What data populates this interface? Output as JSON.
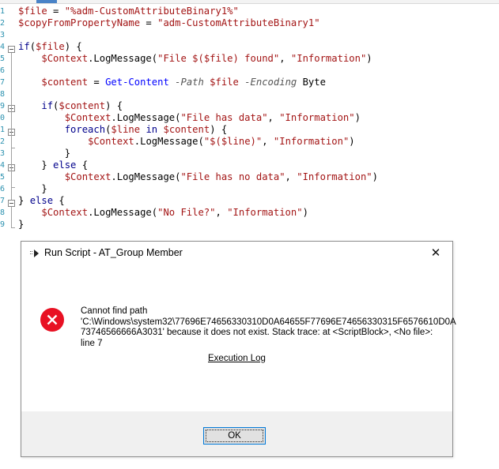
{
  "editor": {
    "gutter_numbers": [
      "1",
      "2",
      "3",
      "4",
      "5",
      "6",
      "7",
      "8",
      "9",
      "0",
      "1",
      "2",
      "3",
      "4",
      "5",
      "6",
      "7",
      "8",
      "9"
    ],
    "lines": [
      [
        [
          "var",
          "$file"
        ],
        [
          "op",
          " = "
        ],
        [
          "str",
          "\"%adm-CustomAttributeBinary1%\""
        ]
      ],
      [
        [
          "var",
          "$copyFromPropertyName"
        ],
        [
          "op",
          " = "
        ],
        [
          "str",
          "\"adm-CustomAttributeBinary1\""
        ]
      ],
      [],
      [
        [
          "kw",
          "if"
        ],
        [
          "pl",
          "("
        ],
        [
          "var",
          "$file"
        ],
        [
          "pl",
          ") {"
        ]
      ],
      [
        [
          "pl",
          "    "
        ],
        [
          "var",
          "$Context"
        ],
        [
          "pl",
          ".LogMessage("
        ],
        [
          "str",
          "\"File $($file) found\""
        ],
        [
          "pl",
          ", "
        ],
        [
          "str",
          "\"Information\""
        ],
        [
          "pl",
          ")"
        ]
      ],
      [],
      [
        [
          "pl",
          "    "
        ],
        [
          "var",
          "$content"
        ],
        [
          "op",
          " = "
        ],
        [
          "cmd",
          "Get-Content"
        ],
        [
          "pl",
          " "
        ],
        [
          "prm",
          "-Path"
        ],
        [
          "pl",
          " "
        ],
        [
          "var",
          "$file"
        ],
        [
          "pl",
          " "
        ],
        [
          "prm",
          "-Encoding"
        ],
        [
          "pl",
          " Byte"
        ]
      ],
      [],
      [
        [
          "pl",
          "    "
        ],
        [
          "kw",
          "if"
        ],
        [
          "pl",
          "("
        ],
        [
          "var",
          "$content"
        ],
        [
          "pl",
          ") {"
        ]
      ],
      [
        [
          "pl",
          "        "
        ],
        [
          "var",
          "$Context"
        ],
        [
          "pl",
          ".LogMessage("
        ],
        [
          "str",
          "\"File has data\""
        ],
        [
          "pl",
          ", "
        ],
        [
          "str",
          "\"Information\""
        ],
        [
          "pl",
          ")"
        ]
      ],
      [
        [
          "pl",
          "        "
        ],
        [
          "kw",
          "foreach"
        ],
        [
          "pl",
          "("
        ],
        [
          "var",
          "$line"
        ],
        [
          "pl",
          " "
        ],
        [
          "kw",
          "in"
        ],
        [
          "pl",
          " "
        ],
        [
          "var",
          "$content"
        ],
        [
          "pl",
          ") {"
        ]
      ],
      [
        [
          "pl",
          "            "
        ],
        [
          "var",
          "$Context"
        ],
        [
          "pl",
          ".LogMessage("
        ],
        [
          "str",
          "\"$($line)\""
        ],
        [
          "pl",
          ", "
        ],
        [
          "str",
          "\"Information\""
        ],
        [
          "pl",
          ")"
        ]
      ],
      [
        [
          "pl",
          "        }"
        ]
      ],
      [
        [
          "pl",
          "    } "
        ],
        [
          "kw",
          "else"
        ],
        [
          "pl",
          " {"
        ]
      ],
      [
        [
          "pl",
          "        "
        ],
        [
          "var",
          "$Context"
        ],
        [
          "pl",
          ".LogMessage("
        ],
        [
          "str",
          "\"File has no data\""
        ],
        [
          "pl",
          ", "
        ],
        [
          "str",
          "\"Information\""
        ],
        [
          "pl",
          ")"
        ]
      ],
      [
        [
          "pl",
          "    }"
        ]
      ],
      [
        [
          "pl",
          "} "
        ],
        [
          "kw",
          "else"
        ],
        [
          "pl",
          " {"
        ]
      ],
      [
        [
          "pl",
          "    "
        ],
        [
          "var",
          "$Context"
        ],
        [
          "pl",
          ".LogMessage("
        ],
        [
          "str",
          "\"No File?\""
        ],
        [
          "pl",
          ", "
        ],
        [
          "str",
          "\"Information\""
        ],
        [
          "pl",
          ")"
        ]
      ],
      [
        [
          "pl",
          "}"
        ]
      ]
    ]
  },
  "dialog": {
    "title": "Run Script - AT_Group Member",
    "close_glyph": "✕",
    "icon": "error-icon",
    "message_lines": [
      "Cannot find path",
      "'C:\\Windows\\system32\\77696E74656330310D0A64655F77696E74656330315F6576610D0A",
      "73746566666A3031' because it does not exist. Stack trace: at <ScriptBlock>, <No file>:",
      "line 7"
    ],
    "execution_log_link": "Execution Log",
    "ok_label": "OK"
  },
  "colors": {
    "variable": "#a31515",
    "keyword": "#00008b",
    "cmdlet": "#0000ff",
    "error_icon": "#e81123",
    "button_border": "#0078d7"
  }
}
